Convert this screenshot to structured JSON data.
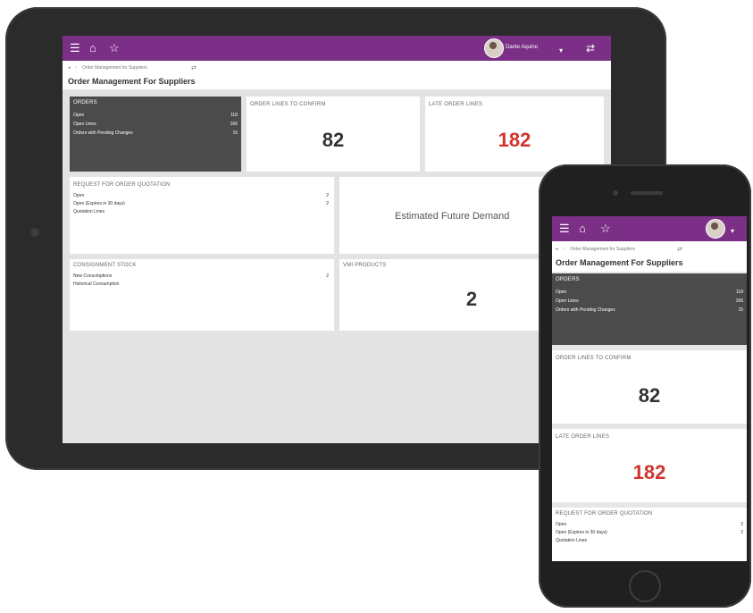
{
  "app": {
    "page_title": "Order Management For Suppliers",
    "breadcrumb": "Order Management for Suppliers",
    "user_name": "Dante Aquino",
    "accent": "#7b2f86",
    "alert": "#d2332e"
  },
  "topbar": {
    "menu_icon": "☰",
    "home_icon": "⌂",
    "star_icon": "☆",
    "chevron": "▾",
    "nav_back": "◂",
    "nav_sep": "›",
    "link_icon": "⇄"
  },
  "tiles": {
    "orders": {
      "title": "ORDERS",
      "rows": [
        {
          "label": "Open",
          "value": "118"
        },
        {
          "label": "Open Lines",
          "value": "166"
        },
        {
          "label": "Orders with Pending Changes",
          "value": "15"
        }
      ]
    },
    "order_lines_to_confirm": {
      "title": "ORDER LINES TO CONFIRM",
      "value": "82"
    },
    "late_order_lines": {
      "title": "LATE ORDER LINES",
      "value": "182"
    },
    "rfq": {
      "title": "REQUEST FOR ORDER QUOTATION",
      "rows": [
        {
          "label": "Open",
          "value": "2"
        },
        {
          "label": "Open (Expires in 30 days)",
          "value": "2"
        },
        {
          "label": "Quotation Lines",
          "value": ""
        }
      ]
    },
    "estimated_future_demand": {
      "title": "Estimated Future Demand"
    },
    "consignment_stock": {
      "title": "CONSIGNMENT STOCK",
      "rows": [
        {
          "label": "New Consumptions",
          "value": "2"
        },
        {
          "label": "Historical Consumption",
          "value": ""
        }
      ]
    },
    "vmi_products": {
      "title": "VMI PRODUCTS",
      "value": "2"
    }
  }
}
